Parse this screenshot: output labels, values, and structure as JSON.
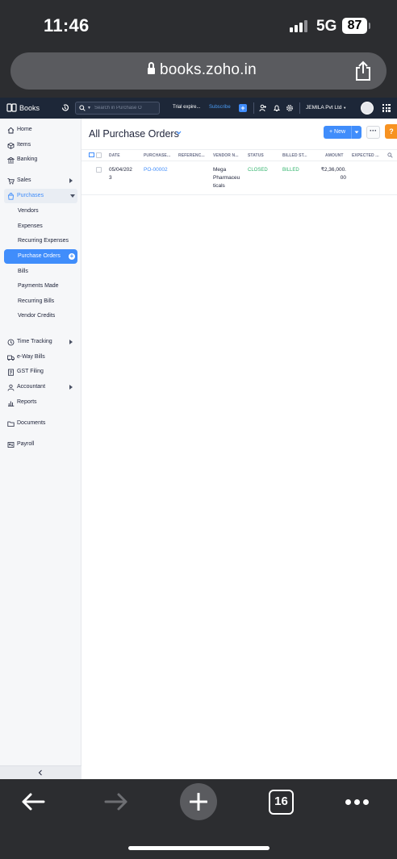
{
  "status_bar": {
    "time": "11:46",
    "network": "5G",
    "battery": "87"
  },
  "browser": {
    "url": "books.zoho.in",
    "tab_count": "16"
  },
  "app": {
    "name": "Books",
    "search_placeholder": "Search in Purchase O",
    "trial_text": "Trial expire...",
    "subscribe_label": "Subscribe",
    "org_name": "JEMILA Pvt Ltd"
  },
  "sidebar": {
    "nav": [
      {
        "label": "Home",
        "icon": "home-icon"
      },
      {
        "label": "Items",
        "icon": "box-icon"
      },
      {
        "label": "Banking",
        "icon": "bank-icon"
      },
      {
        "label": "Sales",
        "icon": "cart-icon"
      },
      {
        "label": "Purchases",
        "icon": "bag-icon"
      }
    ],
    "purchases_sub": [
      "Vendors",
      "Expenses",
      "Recurring Expenses",
      "Purchase Orders",
      "Bills",
      "Payments Made",
      "Recurring Bills",
      "Vendor Credits"
    ],
    "nav2": [
      {
        "label": "Time Tracking",
        "icon": "clock-icon"
      },
      {
        "label": "e-Way Bills",
        "icon": "truck-icon"
      },
      {
        "label": "GST Filing",
        "icon": "document-icon"
      },
      {
        "label": "Accountant",
        "icon": "user-icon"
      },
      {
        "label": "Reports",
        "icon": "bar-chart-icon"
      },
      {
        "label": "Documents",
        "icon": "folder-icon"
      },
      {
        "label": "Payroll",
        "icon": "payroll-icon"
      }
    ]
  },
  "main": {
    "title": "All Purchase Orders",
    "new_label": "New",
    "help_label": "?",
    "columns": [
      "DATE",
      "PURCHASE...",
      "REFERENC...",
      "VENDOR N...",
      "STATUS",
      "BILLED ST...",
      "AMOUNT",
      "EXPECTED ..."
    ],
    "rows": [
      {
        "date_line1": "05/04/202",
        "date_line2": "3",
        "purchase_order": "PO-00002",
        "reference": "",
        "vendor_line1": "Mega",
        "vendor_line2": "Pharmaceu",
        "vendor_line3": "ticals",
        "status": "CLOSED",
        "billed_status": "BILLED",
        "amount_line1": "₹2,36,000.",
        "amount_line2": "00",
        "expected": ""
      }
    ]
  },
  "colors": {
    "accent": "#408dfb",
    "topbar": "#1d2738",
    "status_green": "#2fb36b",
    "help_orange": "#f79221"
  }
}
